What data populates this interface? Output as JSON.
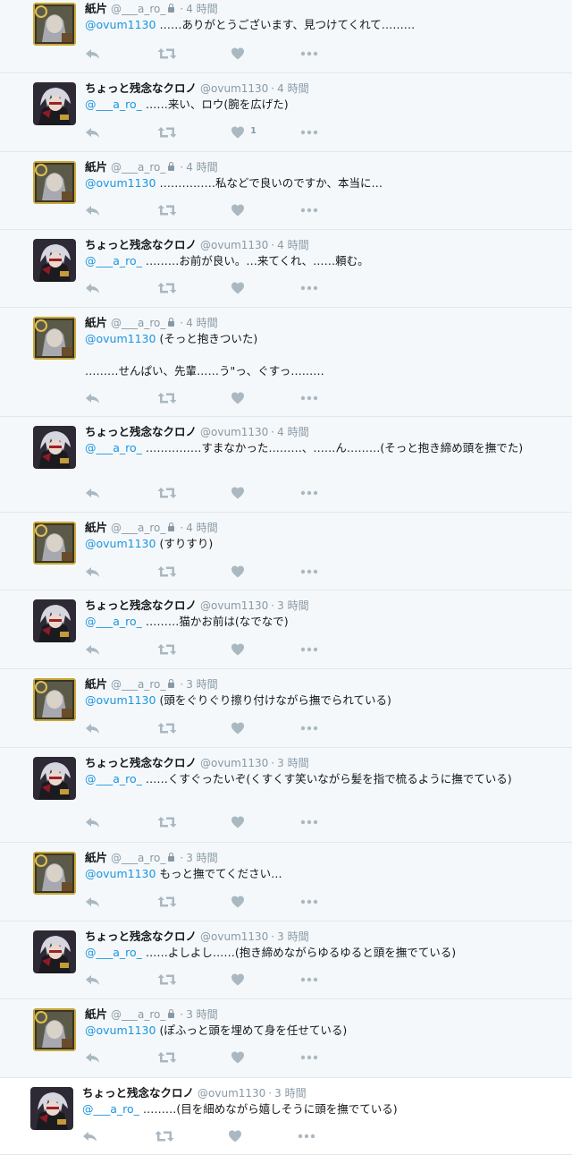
{
  "users": {
    "kamikata": {
      "name": "紙片",
      "handle": "@___a_ro_",
      "protected": true
    },
    "chrono": {
      "name": "ちょっと残念なクロノ",
      "handle": "@ovum1130",
      "protected": false
    }
  },
  "tweets": [
    {
      "user": "kamikata",
      "name": "紙片",
      "handle": "@___a_ro_",
      "time": "4 時間",
      "mention": "@ovum1130",
      "text": " ……ありがとうございます、見つけてくれて………",
      "likes": ""
    },
    {
      "user": "chrono",
      "name": "ちょっと残念なクロノ",
      "handle": "@ovum1130",
      "time": "4 時間",
      "mention": "@___a_ro_",
      "text": " ……来い、ロウ(腕を広げた)",
      "likes": "1"
    },
    {
      "user": "kamikata",
      "name": "紙片",
      "handle": "@___a_ro_",
      "time": "4 時間",
      "mention": "@ovum1130",
      "text": " ……………私などで良いのですか、本当に…",
      "likes": ""
    },
    {
      "user": "chrono",
      "name": "ちょっと残念なクロノ",
      "handle": "@ovum1130",
      "time": "4 時間",
      "mention": "@___a_ro_",
      "text": " ………お前が良い。…来てくれ、……頼む。",
      "likes": ""
    },
    {
      "user": "kamikata",
      "name": "紙片",
      "handle": "@___a_ro_",
      "time": "4 時間",
      "mention": "@ovum1130",
      "text": " (そっと抱きついた)\n\n………せんぱい、先輩……う\"っ、ぐすっ………",
      "likes": ""
    },
    {
      "user": "chrono",
      "name": "ちょっと残念なクロノ",
      "handle": "@ovum1130",
      "time": "4 時間",
      "mention": "@___a_ro_",
      "text": " ……………すまなかった………、……ん………(そっと抱き締め頭を撫でた)",
      "likes": ""
    },
    {
      "user": "kamikata",
      "name": "紙片",
      "handle": "@___a_ro_",
      "time": "4 時間",
      "mention": "@ovum1130",
      "text": " (すりすり)",
      "likes": ""
    },
    {
      "user": "chrono",
      "name": "ちょっと残念なクロノ",
      "handle": "@ovum1130",
      "time": "3 時間",
      "mention": "@___a_ro_",
      "text": " ………猫かお前は(なでなで)",
      "likes": ""
    },
    {
      "user": "kamikata",
      "name": "紙片",
      "handle": "@___a_ro_",
      "time": "3 時間",
      "mention": "@ovum1130",
      "text": " (頭をぐりぐり擦り付けながら撫でられている)",
      "likes": ""
    },
    {
      "user": "chrono",
      "name": "ちょっと残念なクロノ",
      "handle": "@ovum1130",
      "time": "3 時間",
      "mention": "@___a_ro_",
      "text": " ……くすぐったいぞ(くすくす笑いながら髪を指で梳るように撫でている)",
      "likes": ""
    },
    {
      "user": "kamikata",
      "name": "紙片",
      "handle": "@___a_ro_",
      "time": "3 時間",
      "mention": "@ovum1130",
      "text": " もっと撫でてください…",
      "likes": ""
    },
    {
      "user": "chrono",
      "name": "ちょっと残念なクロノ",
      "handle": "@ovum1130",
      "time": "3 時間",
      "mention": "@___a_ro_",
      "text": " ……よしよし……(抱き締めながらゆるゆると頭を撫でている)",
      "likes": ""
    },
    {
      "user": "kamikata",
      "name": "紙片",
      "handle": "@___a_ro_",
      "time": "3 時間",
      "mention": "@ovum1130",
      "text": " (ぽふっと頭を埋めて身を任せている)",
      "likes": ""
    },
    {
      "user": "chrono",
      "name": "ちょっと残念なクロノ",
      "handle": "@ovum1130",
      "time": "3 時間",
      "mention": "@___a_ro_",
      "text": " ………(目を細めながら嬉しそうに頭を撫でている)",
      "likes": ""
    }
  ],
  "icons": {
    "reply": "reply-icon",
    "retweet": "retweet-icon",
    "like": "heart-icon",
    "more": "more-icon",
    "lock": "lock-icon"
  },
  "colors": {
    "mention": "#1b95e0",
    "muted": "#8899a6",
    "background": "#f5f8fa"
  }
}
